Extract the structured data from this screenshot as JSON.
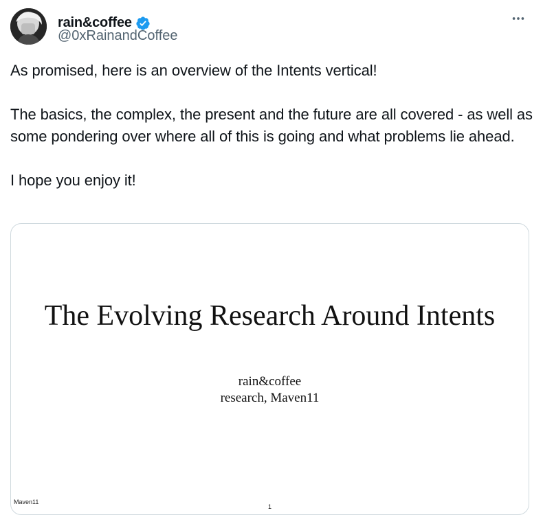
{
  "tweet": {
    "author": {
      "display_name": "rain&coffee",
      "handle": "@0xRainandCoffee",
      "verified": true,
      "verified_color": "#1d9bf0"
    },
    "more_icon": "more-horizontal-icon",
    "text": {
      "p1": "As promised, here is an overview of the Intents vertical!",
      "p2": "The basics, the complex, the present and the future are all covered - as well as some pondering over where all of this is going and what problems lie ahead.",
      "p3": "I hope you enjoy it!"
    },
    "media": {
      "slide_title": "The Evolving Research Around Intents",
      "author": "rain&coffee",
      "affiliation": "research, Maven11",
      "footer_left": "Maven11",
      "page_number": "1"
    }
  }
}
